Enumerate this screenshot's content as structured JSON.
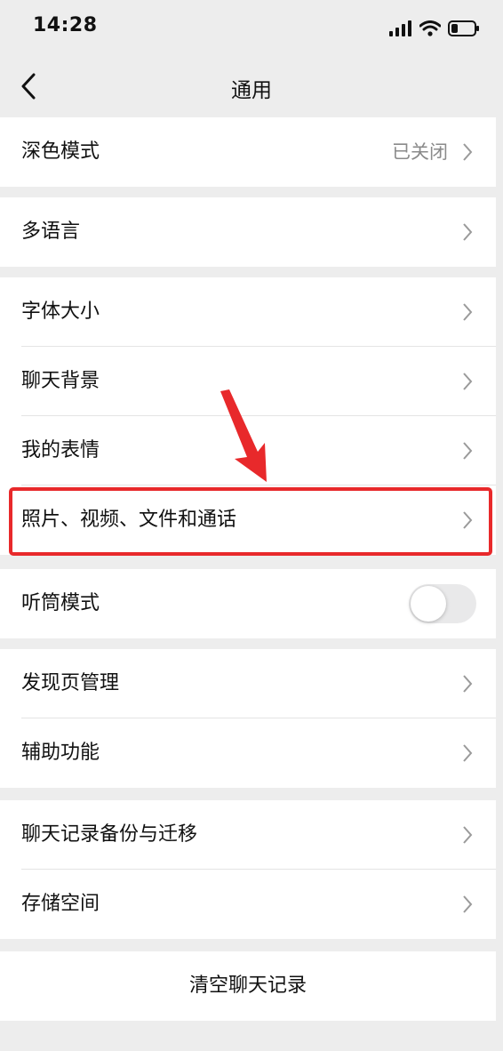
{
  "status_bar": {
    "time": "14:28",
    "icons": [
      "signal-icon",
      "wifi-icon",
      "battery-icon"
    ]
  },
  "nav": {
    "title": "通用",
    "back_icon": "back-chevron-icon"
  },
  "groups": {
    "dark_mode": {
      "label": "深色模式",
      "value": "已关闭"
    },
    "language": {
      "label": "多语言"
    },
    "font_size": {
      "label": "字体大小"
    },
    "chat_background": {
      "label": "聊天背景"
    },
    "my_stickers": {
      "label": "我的表情"
    },
    "media_files": {
      "label": "照片、视频、文件和通话"
    },
    "earpiece_mode": {
      "label": "听筒模式",
      "toggle_on": false
    },
    "discover_manage": {
      "label": "发现页管理"
    },
    "accessibility": {
      "label": "辅助功能"
    },
    "chat_backup": {
      "label": "聊天记录备份与迁移"
    },
    "storage": {
      "label": "存储空间"
    },
    "clear_history": {
      "label": "清空聊天记录"
    }
  },
  "annotation": {
    "highlight_color": "#e8292b",
    "highlighted_item": "media_files"
  },
  "colors": {
    "page_background": "#ededed",
    "row_background": "#ffffff",
    "secondary_text": "#8a8a8a"
  }
}
